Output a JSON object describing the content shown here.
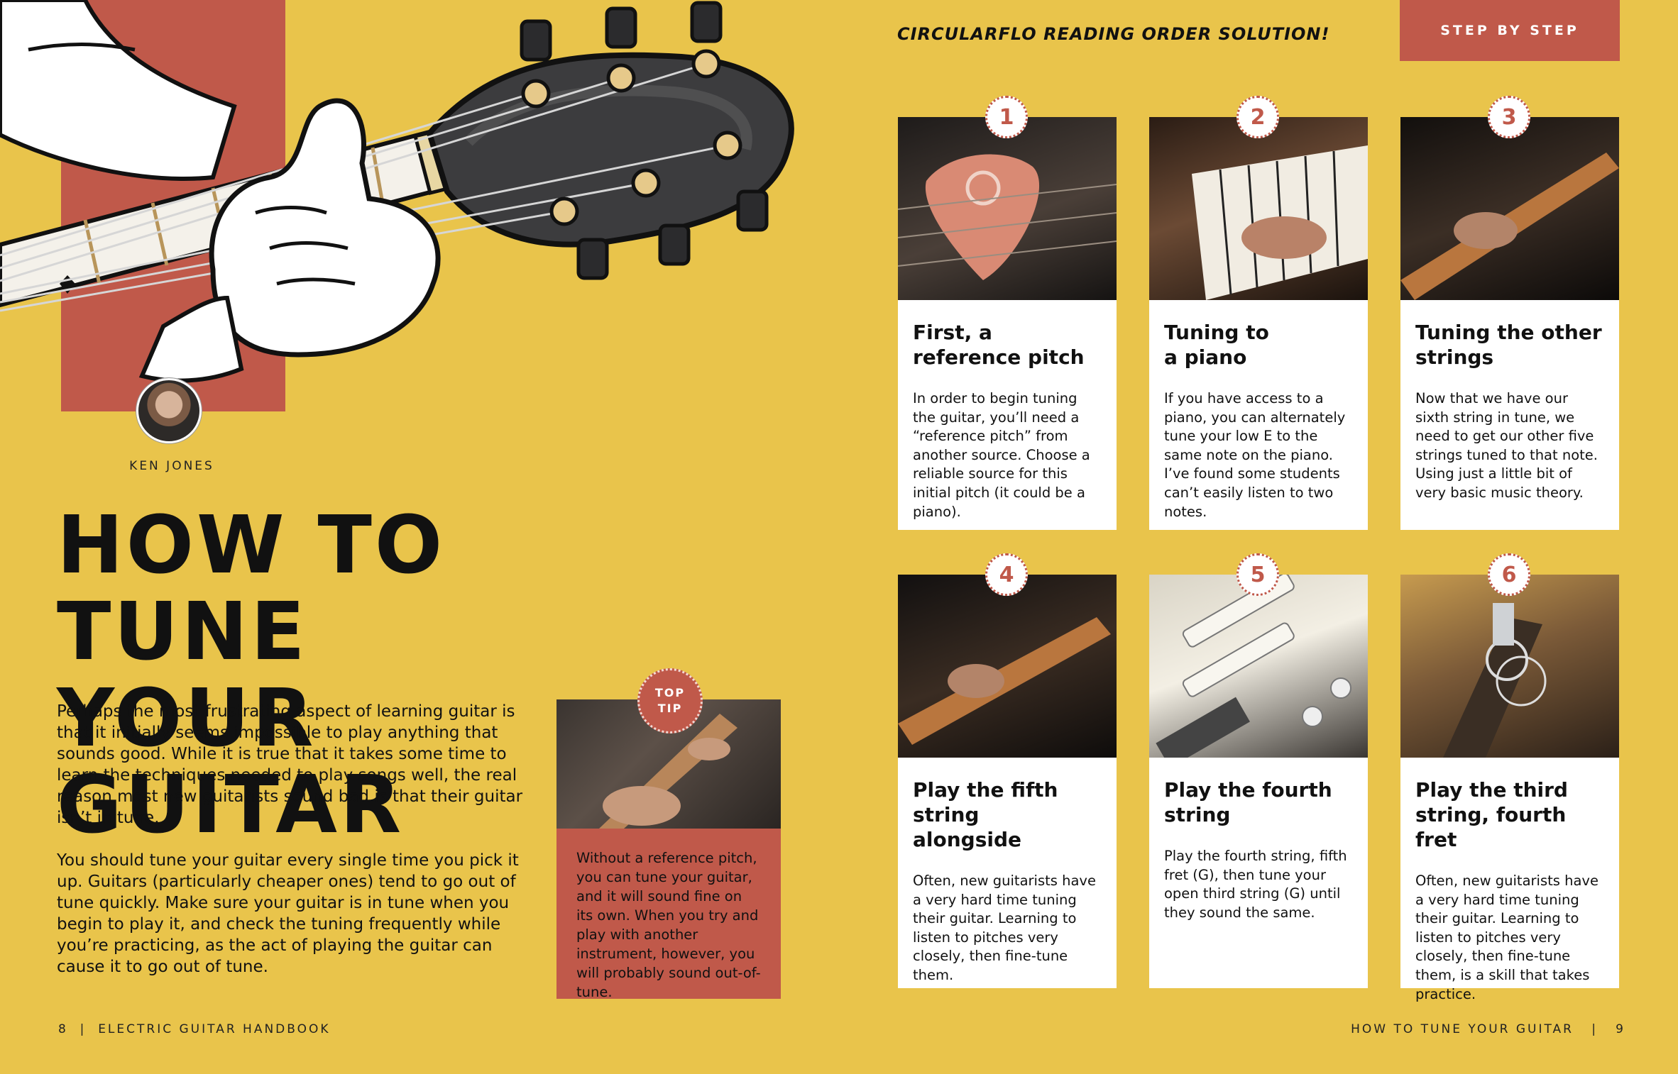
{
  "left_page": {
    "author": {
      "name": "KEN JONES"
    },
    "headline": {
      "line1": "HOW TO TUNE",
      "line2": "YOUR GUITAR"
    },
    "intro": {
      "p1": "Perhaps the most frustrating aspect of learning guitar is that it initially seems impossible to play anything that sounds good. While it is true that it takes some time to learn the techniques needed to play songs well, the real reason most new guitarists sound bad is that their guitar isn’t in tune.",
      "p2": "You should tune your guitar every single time you pick it up. Guitars (particularly cheaper ones) tend to go out of tune quickly. Make sure your guitar is in tune when you begin to play it, and check the tuning frequently while you’re practicing, as the act of playing the guitar can cause it to go out of tune."
    },
    "tip": {
      "badge_line1": "TOP",
      "badge_line2": "TIP",
      "text": "Without a reference pitch, you can tune your guitar, and it will sound fine on its own. When you try and play with another instrument, however, you will probably sound out-of-tune."
    },
    "footer": {
      "page": "8",
      "sep": "|",
      "publication": "ELECTRIC GUITAR HANDBOOK"
    }
  },
  "right_page": {
    "kicker": "CIRCULARFLO READING ORDER SOLUTION!",
    "section_tab": "STEP BY STEP",
    "steps": [
      {
        "num": "1",
        "title_line1": "First, a",
        "title_line2": "reference pitch",
        "text": "In order to begin tuning the guitar, you’ll need a “reference pitch” from another source. Choose a reliable source for this initial pitch (it could be a piano)."
      },
      {
        "num": "2",
        "title_line1": "Tuning to",
        "title_line2": "a piano",
        "text": "If you have access to a piano, you can alternately tune your low E to the same note on the piano. I’ve found some students can’t easily listen to two notes."
      },
      {
        "num": "3",
        "title_line1": "Tuning the other",
        "title_line2": "strings",
        "text": "Now that we have our sixth string in tune, we need to get our other five strings tuned to that note. Using just a little bit of very basic music theory."
      },
      {
        "num": "4",
        "title_line1": "Play the fifth string",
        "title_line2": "alongside",
        "text": "Often, new guitarists have a very hard time tuning their guitar. Learning to listen to pitches very closely, then fine-tune them."
      },
      {
        "num": "5",
        "title_line1": "Play the fourth",
        "title_line2": "string",
        "text": "Play the fourth string, fifth fret (G), then tune your open third string (G) until they sound the same."
      },
      {
        "num": "6",
        "title_line1": "Play the third",
        "title_line2": "string, fourth fret",
        "text": "Often, new guitarists have a very hard time tuning their guitar. Learning to listen to pitches very closely, then fine-tune them, is a skill that takes practice."
      }
    ],
    "footer": {
      "title": "HOW TO TUNE YOUR GUITAR",
      "sep": "|",
      "page": "9"
    }
  },
  "colors": {
    "background": "#e9c44b",
    "accent_red": "#c0594a",
    "card": "#ffffff",
    "ink": "#111111"
  }
}
